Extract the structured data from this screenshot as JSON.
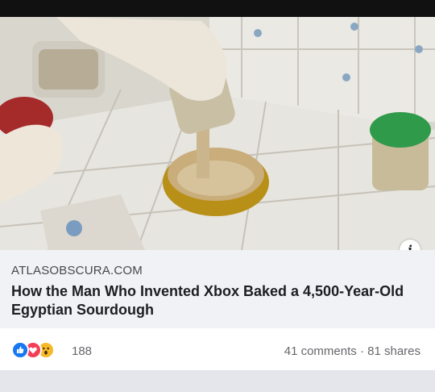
{
  "link_preview": {
    "domain": "ATLASOBSCURA.COM",
    "headline": "How the Man Who Invented Xbox Baked a 4,500-Year-Old Egyptian Sourdough",
    "info_icon": "i"
  },
  "engagement": {
    "reaction_icons": [
      "like-icon",
      "love-icon",
      "wow-icon"
    ],
    "reaction_count": "188",
    "comments": "41 comments",
    "separator": "·",
    "shares": "81 shares"
  },
  "colors": {
    "like": "#1877f2",
    "love": "#f33e58",
    "wow": "#f7b928",
    "panel_bg": "#f0f2f5",
    "meta_text": "#65676b"
  }
}
